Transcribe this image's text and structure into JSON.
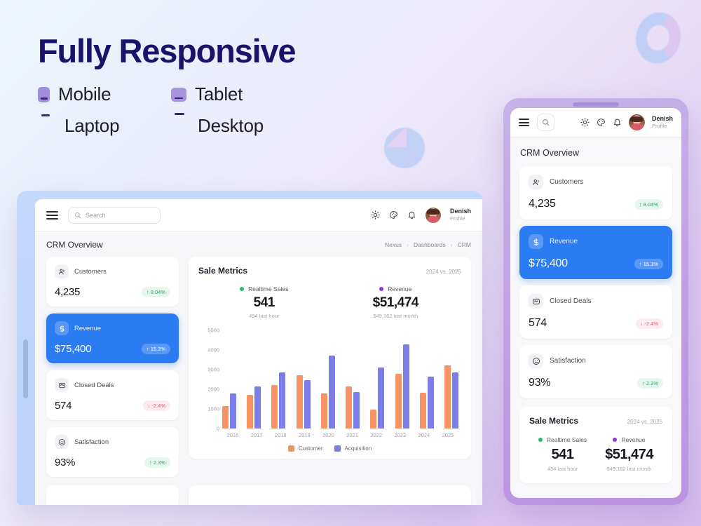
{
  "hero": {
    "title": "Fully Responsive",
    "devices": [
      {
        "label": "Mobile",
        "icon": "mobile-icon"
      },
      {
        "label": "Tablet",
        "icon": "tablet-icon"
      },
      {
        "label": "Laptop",
        "icon": "laptop-icon"
      },
      {
        "label": "Desktop",
        "icon": "desktop-icon"
      }
    ]
  },
  "colors": {
    "accent_blue": "#2b7cf3",
    "headline_purple": "#1d1269",
    "bar_customer": "#f79263",
    "bar_acquisition": "#7b7ee8",
    "positive_green": "#23a866",
    "negative_red": "#e8536d",
    "realtime_dot": "#22c55e",
    "revenue_dot": "#9333ea"
  },
  "dashboard": {
    "topbar": {
      "menu_icon": "hamburger-icon",
      "search_placeholder": "Search",
      "search_value": "",
      "search_icon": "search-icon",
      "theme_icon": "sun-icon",
      "palette_icon": "palette-icon",
      "bell_icon": "bell-icon",
      "user_name": "Denish",
      "user_role": "Profile"
    },
    "page_title": "CRM Overview",
    "breadcrumb": [
      "Nexus",
      "Dashboards",
      "CRM"
    ],
    "breadcrumb_separator": "›",
    "stats": [
      {
        "icon": "users-icon",
        "label": "Customers",
        "value": "4,235",
        "delta": "8.04%",
        "direction": "up",
        "arrow": "↑",
        "active": false
      },
      {
        "icon": "dollar-icon",
        "label": "Revenue",
        "value": "$75,400",
        "delta": "15.3%",
        "direction": "up",
        "arrow": "↑",
        "active": true
      },
      {
        "icon": "handshake-icon",
        "label": "Closed Deals",
        "value": "574",
        "delta": "-2.4%",
        "direction": "down",
        "arrow": "↓",
        "active": false
      },
      {
        "icon": "smiley-icon",
        "label": "Satisfaction",
        "value": "93%",
        "delta": "2.3%",
        "direction": "up",
        "arrow": "↑",
        "active": false
      }
    ],
    "sale_metrics": {
      "title": "Sale Metrics",
      "period": "2024 vs. 2025",
      "metrics": [
        {
          "label": "Realtime Sales",
          "dot": "#22c55e",
          "value": "541",
          "note": "494 last hour"
        },
        {
          "label": "Revenue",
          "dot": "#9333ea",
          "value": "$51,474",
          "note": "$49,162 last month"
        }
      ]
    }
  },
  "chart_data": {
    "type": "bar",
    "title": "Sale Metrics",
    "subtitle": "2024 vs. 2025",
    "xlabel": "",
    "ylabel": "",
    "ylim": [
      0,
      5000
    ],
    "yticks": [
      0,
      1000,
      2000,
      3000,
      4000,
      5000
    ],
    "ytick_labels": [
      "0",
      "1000",
      "2000",
      "3000",
      "4000",
      "5000"
    ],
    "grid": false,
    "legend_position": "bottom-center",
    "categories": [
      "2016",
      "2017",
      "2018",
      "2019",
      "2020",
      "2021",
      "2022",
      "2023",
      "2024",
      "2025"
    ],
    "series": [
      {
        "name": "Customer",
        "color": "#f79263",
        "values": [
          1130,
          1700,
          2220,
          2700,
          1790,
          2130,
          980,
          2770,
          1810,
          3220
        ]
      },
      {
        "name": "Acquisition",
        "color": "#7b7ee8",
        "values": [
          1780,
          2150,
          2840,
          2450,
          3720,
          1860,
          3110,
          4300,
          2650,
          2850
        ]
      }
    ]
  }
}
